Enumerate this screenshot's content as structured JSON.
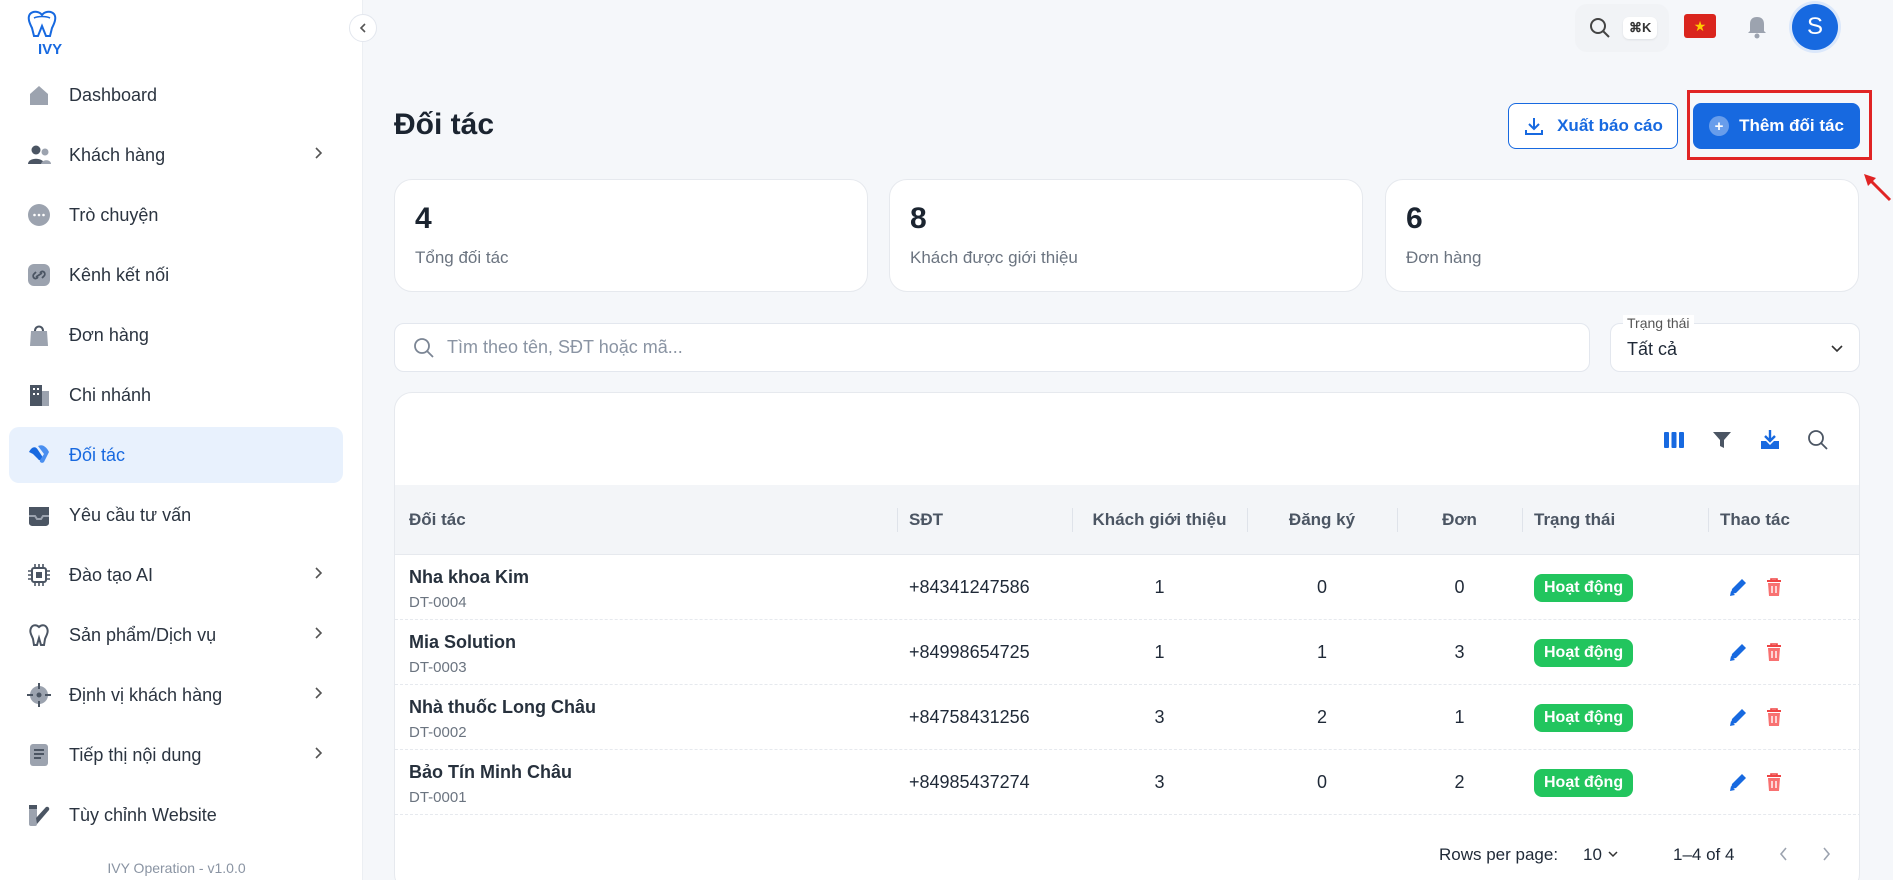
{
  "app": {
    "logo_text": "IVY",
    "version": "IVY Operation - v1.0.0"
  },
  "sidebar": {
    "items": [
      {
        "label": "Dashboard",
        "icon": "home-icon",
        "has_children": false,
        "active": false
      },
      {
        "label": "Khách hàng",
        "icon": "users-icon",
        "has_children": true,
        "active": false
      },
      {
        "label": "Trò chuyện",
        "icon": "chat-icon",
        "has_children": false,
        "active": false
      },
      {
        "label": "Kênh kết nối",
        "icon": "link-icon",
        "has_children": false,
        "active": false
      },
      {
        "label": "Đơn hàng",
        "icon": "shopping-bag-icon",
        "has_children": false,
        "active": false
      },
      {
        "label": "Chi nhánh",
        "icon": "building-icon",
        "has_children": false,
        "active": false
      },
      {
        "label": "Đối tác",
        "icon": "handshake-icon",
        "has_children": false,
        "active": true
      },
      {
        "label": "Yêu cầu tư vấn",
        "icon": "inbox-icon",
        "has_children": false,
        "active": false
      },
      {
        "label": "Đào tạo AI",
        "icon": "chip-icon",
        "has_children": true,
        "active": false
      },
      {
        "label": "Sản phẩm/Dịch vụ",
        "icon": "tooth-icon",
        "has_children": true,
        "active": false
      },
      {
        "label": "Định vị khách hàng",
        "icon": "crosshair-icon",
        "has_children": true,
        "active": false
      },
      {
        "label": "Tiếp thị nội dung",
        "icon": "document-icon",
        "has_children": true,
        "active": false
      },
      {
        "label": "Tùy chỉnh Website",
        "icon": "palette-icon",
        "has_children": false,
        "active": false
      }
    ]
  },
  "topbar": {
    "shortcut": "⌘K",
    "avatar_letter": "S",
    "flag": "★"
  },
  "header": {
    "title": "Đối tác",
    "export_label": "Xuất báo cáo",
    "add_label": "Thêm đối tác"
  },
  "stats": [
    {
      "value": "4",
      "label": "Tổng đối tác"
    },
    {
      "value": "8",
      "label": "Khách được giới thiệu"
    },
    {
      "value": "6",
      "label": "Đơn hàng"
    }
  ],
  "search": {
    "placeholder": "Tìm theo tên, SĐT hoặc mã..."
  },
  "status_filter": {
    "label": "Trạng thái",
    "value": "Tất cả"
  },
  "table": {
    "columns": [
      "Đối tác",
      "SĐT",
      "Khách giới thiệu",
      "Đăng ký",
      "Đơn",
      "Trạng thái",
      "Thao tác"
    ],
    "rows": [
      {
        "name": "Nha khoa Kim",
        "code": "DT-0004",
        "phone": "+84341247586",
        "referred": "1",
        "registered": "0",
        "orders": "0",
        "status": "Hoạt động"
      },
      {
        "name": "Mia Solution",
        "code": "DT-0003",
        "phone": "+84998654725",
        "referred": "1",
        "registered": "1",
        "orders": "3",
        "status": "Hoạt động"
      },
      {
        "name": "Nhà thuốc Long Châu",
        "code": "DT-0002",
        "phone": "+84758431256",
        "referred": "3",
        "registered": "2",
        "orders": "1",
        "status": "Hoạt động"
      },
      {
        "name": "Bảo Tín Minh Châu",
        "code": "DT-0001",
        "phone": "+84985437274",
        "referred": "3",
        "registered": "0",
        "orders": "2",
        "status": "Hoạt động"
      }
    ]
  },
  "pagination": {
    "rows_per_page_label": "Rows per page:",
    "rows_per_page": "10",
    "range": "1–4 of 4"
  },
  "colors": {
    "primary": "#1769e0",
    "success": "#22c55e",
    "danger": "#ef4444",
    "highlight": "#e02424"
  }
}
